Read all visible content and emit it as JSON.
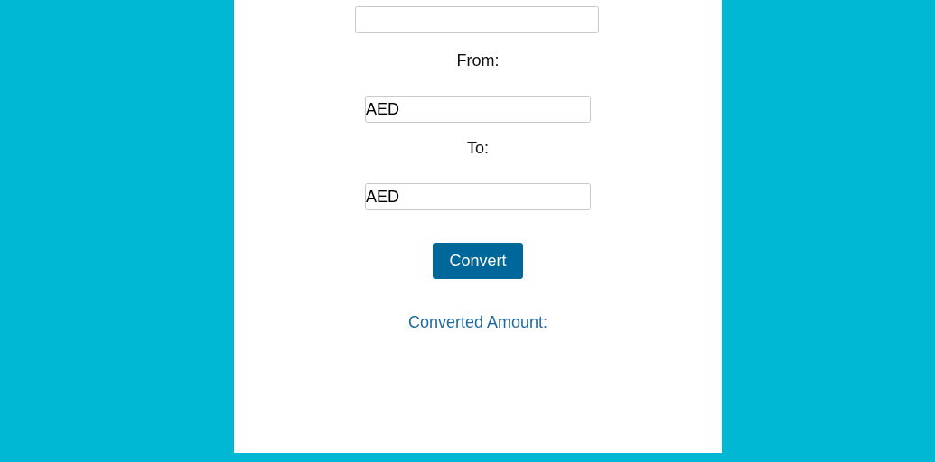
{
  "form": {
    "amount_value": "",
    "from_label": "From:",
    "from_selected": "AED",
    "to_label": "To:",
    "to_selected": "AED",
    "convert_label": "Convert",
    "result_label": "Converted Amount:"
  },
  "colors": {
    "background": "#00b8d4",
    "panel": "#ffffff",
    "button": "#00679a",
    "result_text": "#1d6aa0"
  }
}
